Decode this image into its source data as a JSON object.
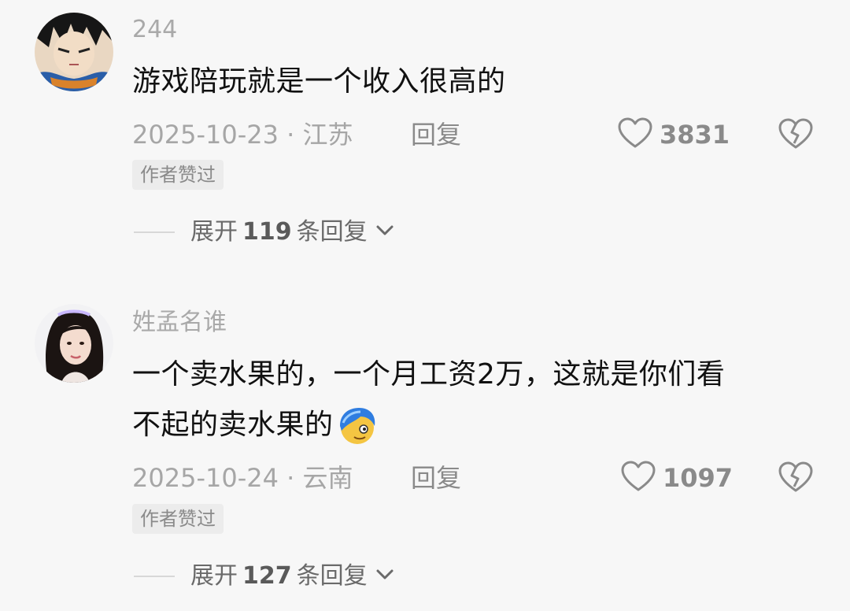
{
  "comments": [
    {
      "username": "244",
      "text_lines": [
        "游戏陪玩就是一个收入很高的"
      ],
      "date_location": "2025-10-23 · 江苏",
      "reply_label": "回复",
      "like_count": "3831",
      "badge": "作者赞过",
      "expand": {
        "prefix": "展开",
        "count": "119",
        "suffix": "条回复"
      }
    },
    {
      "username": "姓孟名谁",
      "text_lines": [
        "一个卖水果的，一个月工资2万，这就是你们看",
        "不起的卖水果的"
      ],
      "date_location": "2025-10-24 · 云南",
      "reply_label": "回复",
      "like_count": "1097",
      "badge": "作者赞过",
      "expand": {
        "prefix": "展开",
        "count": "127",
        "suffix": "条回复"
      }
    }
  ],
  "icons": {
    "like": "heart-outline-icon",
    "dislike": "broken-heart-icon",
    "expand": "chevron-down-icon"
  },
  "colors": {
    "background": "#f7f7f7",
    "text": "#111111",
    "muted": "#a6a6a6",
    "badge_bg": "#ececec"
  }
}
